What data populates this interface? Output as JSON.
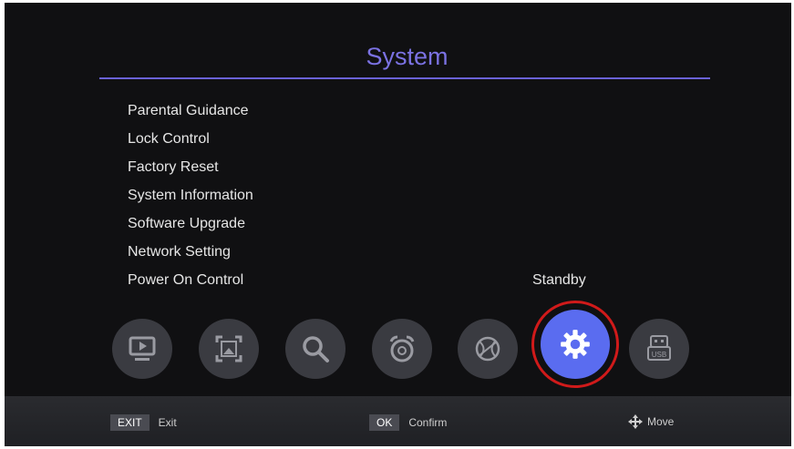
{
  "header": {
    "title": "System"
  },
  "menu": {
    "items": [
      {
        "label": "Parental Guidance",
        "value": ""
      },
      {
        "label": "Lock Control",
        "value": ""
      },
      {
        "label": "Factory Reset",
        "value": ""
      },
      {
        "label": "System Information",
        "value": ""
      },
      {
        "label": "Software Upgrade",
        "value": ""
      },
      {
        "label": "Network Setting",
        "value": ""
      },
      {
        "label": "Power On Control",
        "value": "Standby"
      }
    ]
  },
  "icons": [
    {
      "name": "media-player-icon",
      "active": false
    },
    {
      "name": "picture-icon",
      "active": false
    },
    {
      "name": "search-icon",
      "active": false
    },
    {
      "name": "alarm-clock-icon",
      "active": false
    },
    {
      "name": "network-globe-icon",
      "active": false
    },
    {
      "name": "settings-gear-icon",
      "active": true
    },
    {
      "name": "usb-icon",
      "active": false,
      "label": "USB"
    }
  ],
  "footer": {
    "exit": {
      "key": "EXIT",
      "label": "Exit"
    },
    "ok": {
      "key": "OK",
      "label": "Confirm"
    },
    "move": {
      "icon": "move-arrows-icon",
      "label": "Move"
    }
  },
  "colors": {
    "accent": "#7b72e3",
    "active_icon": "#5a6cf0",
    "highlight_ring": "#d01a1a",
    "background": "#101012"
  }
}
